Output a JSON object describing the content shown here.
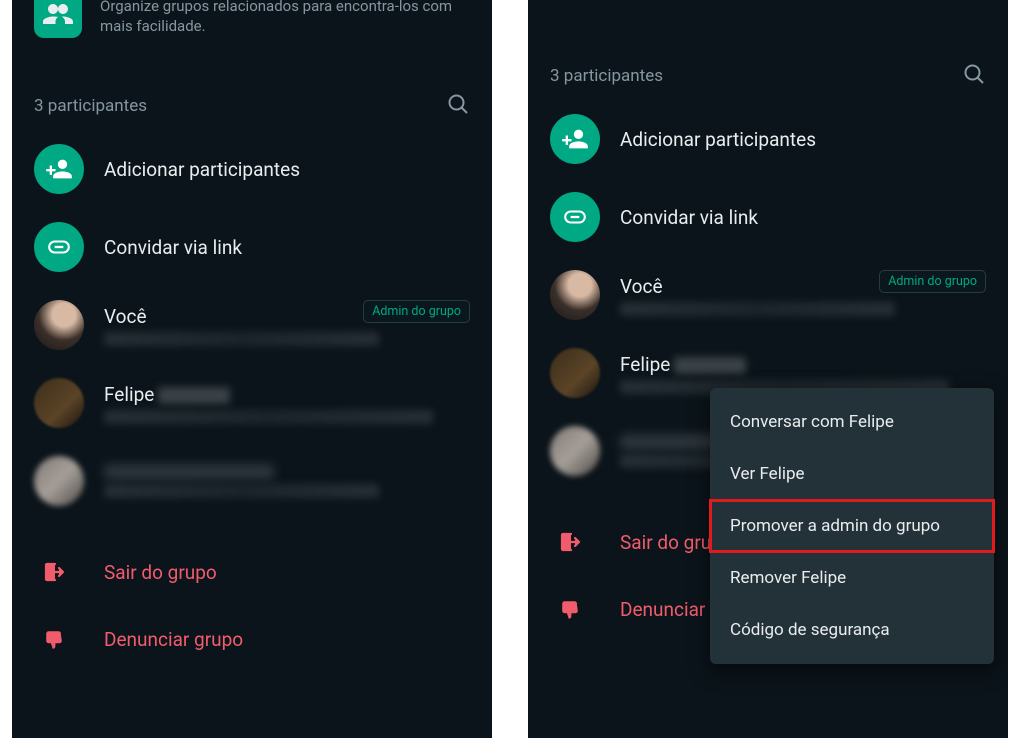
{
  "community_banner": {
    "text": "Organize grupos relacionados para encontra-los com mais facilidade."
  },
  "participants_header": "3 participantes",
  "actions": {
    "add": "Adicionar participantes",
    "invite": "Convidar via link"
  },
  "participants": {
    "you": {
      "name": "Você",
      "badge": "Admin do grupo"
    },
    "p2": {
      "name": "Felipe"
    },
    "p3": {
      "name": ""
    }
  },
  "danger": {
    "leave": "Sair do grupo",
    "report": "Denunciar grupo",
    "leave_truncated": "Sair do gru",
    "report_truncated": "Denunciar g"
  },
  "context_menu": {
    "items": [
      "Conversar com Felipe",
      "Ver Felipe",
      "Promover a admin do grupo",
      "Remover Felipe",
      "Código de segurança"
    ],
    "highlight_index": 2
  },
  "colors": {
    "accent": "#00a884",
    "danger": "#f15c6d",
    "bg": "#0b141a",
    "menu_bg": "#233138",
    "highlight_border": "#e11b1b"
  }
}
